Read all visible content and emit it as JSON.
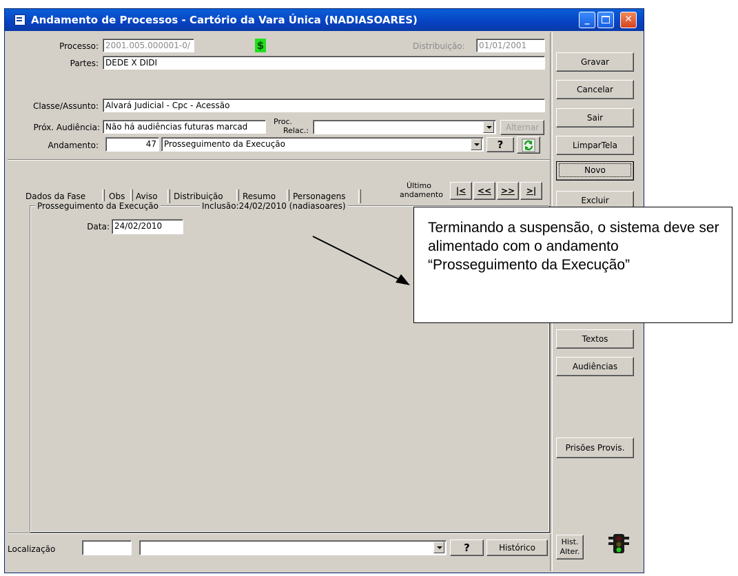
{
  "window": {
    "title": "Andamento de Processos - Cartório da Vara Única (NADIASOARES)"
  },
  "form": {
    "processo_label": "Processo:",
    "processo_value": "2001.005.000001-0/",
    "distribuicao_label": "Distribuição:",
    "distribuicao_value": "01/01/2001",
    "partes_label": "Partes:",
    "partes_value": "DEDE X DIDI",
    "classe_label": "Classe/Assunto:",
    "classe_value": "Alvará Judicial - Cpc - Acessão",
    "prox_audiencia_label": "Próx. Audiência:",
    "prox_audiencia_value": "Não há audiências futuras marcad",
    "proc_relac_label_1": "Proc.",
    "proc_relac_label_2": "Relac.:",
    "proc_relac_value": "",
    "alternar_label": "Alternar",
    "andamento_label": "Andamento:",
    "andamento_code": "47",
    "andamento_value": "Prosseguimento da Execução",
    "help_label": "?"
  },
  "tabs": [
    {
      "label": "Dados da Fase"
    },
    {
      "label": "Obs"
    },
    {
      "label": "Aviso"
    },
    {
      "label": "Distribuição"
    },
    {
      "label": "Resumo"
    },
    {
      "label": "Personagens"
    }
  ],
  "nav": {
    "ultimo_line1": "Último",
    "ultimo_line2": "andamento",
    "first": "|<",
    "prev": "<<",
    "next": ">>",
    "last": ">|"
  },
  "phase": {
    "group_title": "Prosseguimento da Execução",
    "inclusao": "Inclusão:24/02/2010 (nadiasoares)",
    "data_label": "Data:",
    "data_value": "24/02/2010"
  },
  "side_buttons": {
    "gravar": "Gravar",
    "cancelar": "Cancelar",
    "sair": "Sair",
    "limpar": "LimparTela",
    "novo": "Novo",
    "excluir": "Excluir",
    "textos": "Textos",
    "audiencias": "Audiências",
    "prisoes": "Prisões Provis.",
    "hist_line1": "Hist.",
    "hist_line2": "Alter."
  },
  "footer": {
    "localizacao_label": "Localização",
    "localizacao_value": "",
    "localizacao_desc": "",
    "help_label": "?",
    "historico_label": "Histórico"
  },
  "callout": {
    "text": "Terminando a suspensão, o sistema deve ser alimentado com o andamento “Prosseguimento da Execução”"
  },
  "colors": {
    "titlebar": "#0842c2",
    "face": "#d4d0c8",
    "dollar_icon_bg": "#21e021"
  }
}
